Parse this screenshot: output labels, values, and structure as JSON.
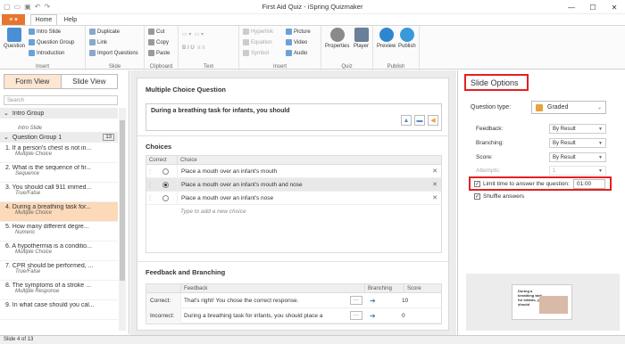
{
  "window": {
    "title": "First Aid Quiz - iSpring Quizmaker"
  },
  "ribbon_tabs": {
    "file": "≡ ▾",
    "home": "Home",
    "help": "Help"
  },
  "ribbon": {
    "insert": {
      "label": "Insert",
      "question": "Question",
      "intro_slide": "Intro Slide",
      "question_group": "Question Group",
      "introduction": "Introduction"
    },
    "slide": {
      "label": "Slide",
      "duplicate": "Duplicate",
      "link": "Link",
      "import_questions": "Import Questions"
    },
    "clipboard": {
      "label": "Clipboard",
      "cut": "Cut",
      "copy": "Copy",
      "paste": "Paste"
    },
    "text": {
      "label": "Text"
    },
    "insert2": {
      "label": "Insert",
      "hyperlink": "Hyperlink",
      "equation": "Equation",
      "symbol": "Symbol",
      "picture": "Picture",
      "video": "Video",
      "audio": "Audio"
    },
    "quiz": {
      "label": "Quiz",
      "properties": "Properties",
      "player": "Player"
    },
    "publish": {
      "label": "Publish",
      "preview": "Preview",
      "publish": "Publish"
    }
  },
  "left": {
    "form_view": "Form View",
    "slide_view": "Slide View",
    "search_placeholder": "Search",
    "intro_group": "Intro Group",
    "intro_slide": "Intro Slide",
    "question_group": "Question Group 1",
    "question_count": "13",
    "items": [
      {
        "title": "1. If a person's chest is not in...",
        "type": "Multiple Choice"
      },
      {
        "title": "2. What is the sequence of fir...",
        "type": "Sequence"
      },
      {
        "title": "3. You should call 911 immed...",
        "type": "True/False"
      },
      {
        "title": "4. During a breathing task for...",
        "type": "Multiple Choice"
      },
      {
        "title": "5. How many different degre...",
        "type": "Numeric"
      },
      {
        "title": "6. A hypothermia is a conditio...",
        "type": "Multiple Choice"
      },
      {
        "title": "7. CPR should be performed, ...",
        "type": "True/False"
      },
      {
        "title": "8. The symptoms of a stroke ...",
        "type": "Multiple Response"
      },
      {
        "title": "9. In what case should you cal...",
        "type": ""
      }
    ]
  },
  "status": "Slide 4 of 13",
  "editor": {
    "section_title": "Multiple Choice Question",
    "question": "During a breathing task for infants, you should",
    "choices_title": "Choices",
    "col_correct": "Correct",
    "col_choice": "Choice",
    "choices": [
      {
        "text": "Place a mouth over an infant's mouth",
        "correct": false
      },
      {
        "text": "Place a mouth over an infant's mouth and nose",
        "correct": true
      },
      {
        "text": "Place a mouth over an infant's nose",
        "correct": false
      }
    ],
    "add_choice": "Type to add a new choice",
    "feedback_title": "Feedback and Branching",
    "col_feedback": "Feedback",
    "col_branching": "Branching",
    "col_score": "Score",
    "correct_label": "Correct:",
    "correct_feedback": "That's right! You chose the correct response.",
    "correct_score": "10",
    "incorrect_label": "Incorrect:",
    "incorrect_feedback": "During a breathing task for infants, you should place a",
    "incorrect_score": "0"
  },
  "options": {
    "title": "Slide Options",
    "question_type_label": "Question type:",
    "question_type": "Graded",
    "feedback_label": "Feedback:",
    "feedback_value": "By Result",
    "branching_label": "Branching:",
    "branching_value": "By Result",
    "score_label": "Score:",
    "score_value": "By Result",
    "attempts_label": "Attempts:",
    "attempts_value": "1",
    "limit_time_label": "Limit time to answer the question:",
    "limit_time_value": "01:00",
    "shuffle_label": "Shuffle answers",
    "thumb_title": "During a breathing task for infants, you should"
  }
}
